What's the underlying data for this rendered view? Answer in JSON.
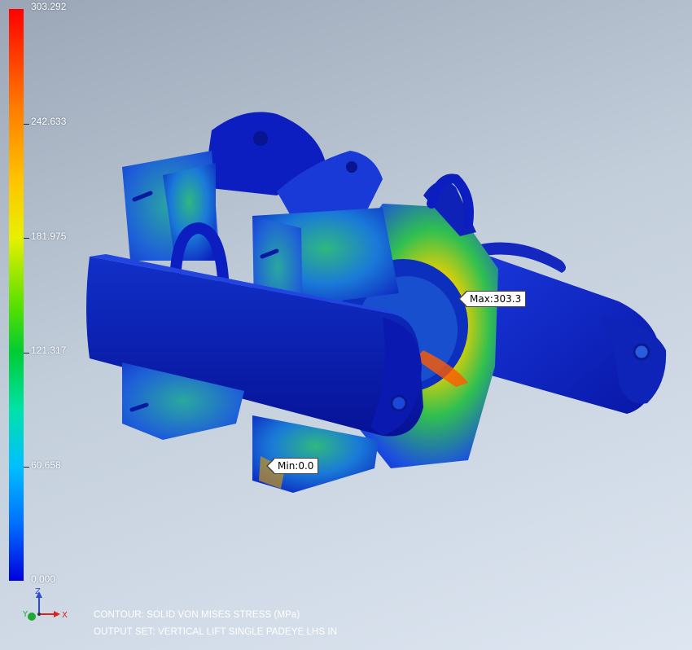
{
  "legend": {
    "labels": [
      "303.292",
      "242.633",
      "181.975",
      "121.317",
      "60.658",
      "0.000"
    ]
  },
  "callouts": {
    "max_label": "Max:303.3",
    "min_label": "Min:0.0"
  },
  "triad": {
    "z": "Z",
    "y": "Y",
    "x": "X"
  },
  "info": {
    "contour": "CONTOUR: SOLID VON MISES STRESS (MPa)",
    "output_set": "OUTPUT SET: VERTICAL LIFT SINGLE PADEYE LHS IN"
  },
  "colors": {
    "low": "#0a1fc8",
    "mid": "#18c84a",
    "high": "#ff2a00"
  }
}
